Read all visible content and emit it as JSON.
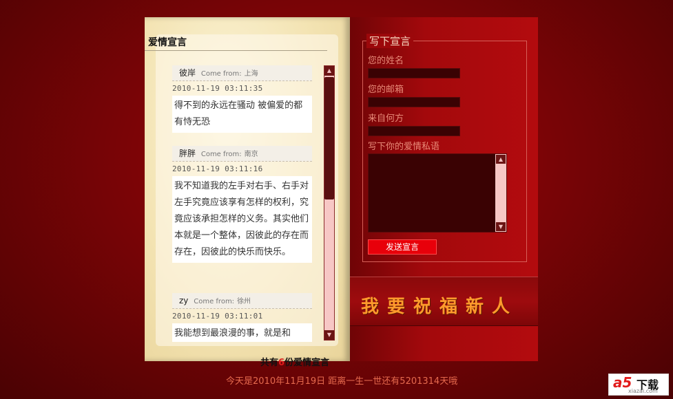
{
  "guestbook": {
    "title": "爱情宣言",
    "messages": [
      {
        "name": "彼岸",
        "from_label": "Come from:",
        "city": "上海",
        "time": "2010-11-19 03:11:35",
        "body": "得不到的永远在骚动 被偏爱的都有恃无恐"
      },
      {
        "name": "胖胖",
        "from_label": "Come from:",
        "city": "南京",
        "time": "2010-11-19 03:11:16",
        "body": "我不知道我的左手对右手、右手对左手究竟应该享有怎样的权利，究竟应该承担怎样的义务。其实他们本就是一个整体，因彼此的存在而存在，因彼此的快乐而快乐。"
      },
      {
        "name": "zy",
        "from_label": "Come from:",
        "city": "徐州",
        "time": "2010-11-19 03:11:01",
        "body": "我能想到最浪漫的事，就是和"
      }
    ]
  },
  "form": {
    "legend": "写下宣言",
    "name_label": "您的姓名",
    "email_label": "您的邮箱",
    "origin_label": "来自何方",
    "message_label": "写下你的爱情私语",
    "submit_label": "发送宣言"
  },
  "banner": {
    "bless_text": "我要祝福新人"
  },
  "footer": {
    "count_prefix": "共有",
    "count": "6",
    "count_suffix": "份爱情宣言",
    "date_line": "今天是2010年11月19日  距离一生一世还有5201314天哦"
  },
  "watermark": {
    "brand": "a5",
    "brand_cn": "下载",
    "url": "xiazai.com"
  },
  "colors": {
    "accent": "#e8000a",
    "bless": "#ff9a2c",
    "footer_text": "#e66a4e"
  }
}
